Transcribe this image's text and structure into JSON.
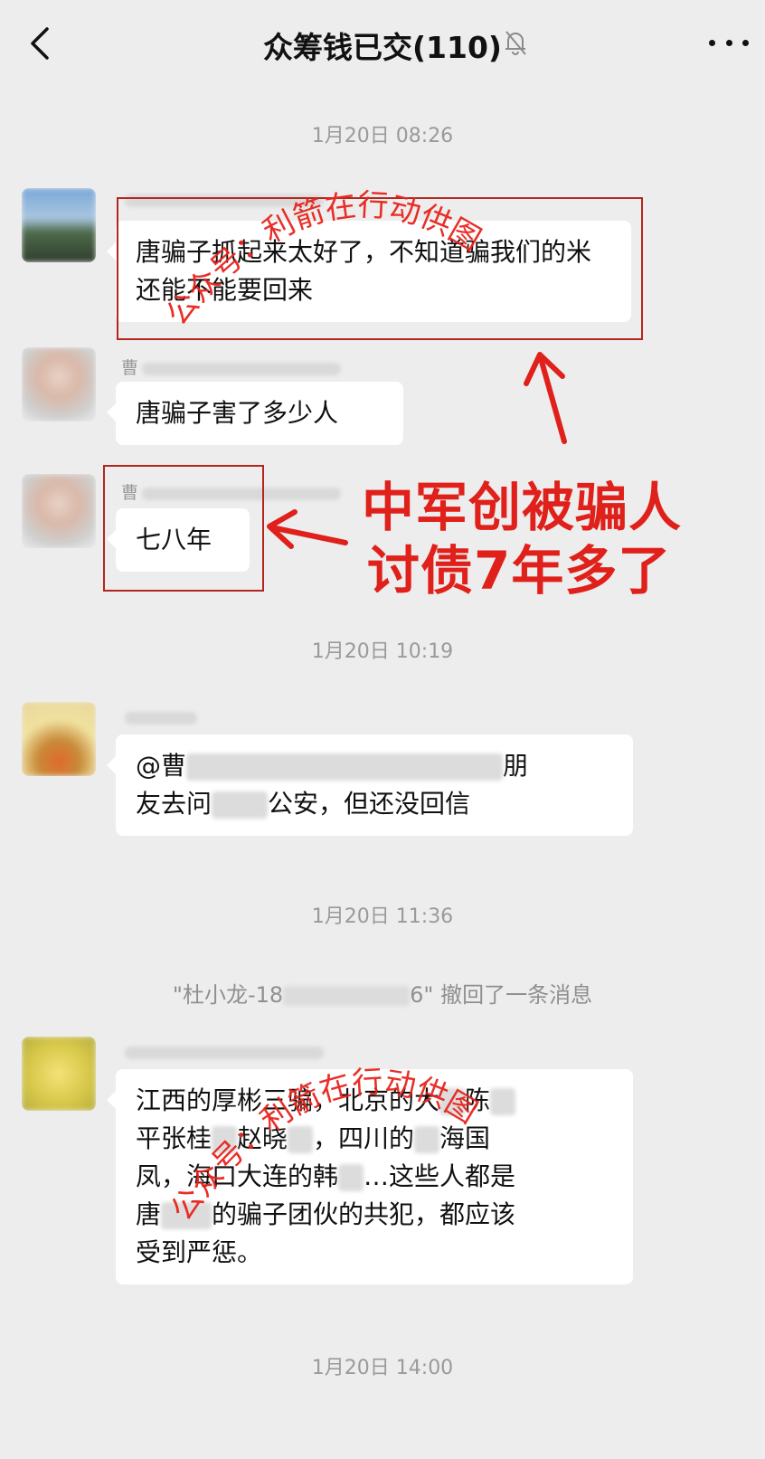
{
  "header": {
    "title": "众筹钱已交(110)",
    "back_icon": "chevron-left-icon",
    "mute_icon": "bell-off-icon",
    "more_icon": "more-dots-icon"
  },
  "times": [
    "1月20日 08:26",
    "1月20日 10:19",
    "1月20日 11:36",
    "1月20日 14:00"
  ],
  "messages": [
    {
      "nickname": "",
      "text": "唐骗子抓起来太好了，不知道骗我们的米还能不能要回来"
    },
    {
      "nickname": "曹",
      "text": "唐骗子害了多少人"
    },
    {
      "nickname": "曹",
      "text": "七八年"
    },
    {
      "nickname": "",
      "text_a": "@曹",
      "text_b": "朋",
      "text_c": "友去问",
      "text_d": "公安，但还没回信"
    },
    {
      "nickname": "",
      "line1_a": "江西的厚彬三骗，北京的大",
      "line1_b": "陈",
      "line2_a": "平张桂",
      "line2_b": "赵晓",
      "line2_c": "，四川的",
      "line2_d": "海国",
      "line3_a": "凤，海口大连的韩",
      "line3_b": "…这些人都是",
      "line4_a": "唐",
      "line4_b": "的骗子团伙的共犯，都应该",
      "line5": "受到严惩。"
    }
  ],
  "system": {
    "prefix": "\"杜小龙-18",
    "suffix": "6\" 撤回了一条消息"
  },
  "annotation": {
    "line1": "中军创被骗人",
    "line2": "讨债7年多了"
  },
  "watermark": {
    "text": "公众号：利箭在行动供图"
  },
  "colors": {
    "annotation_red": "#e0201a",
    "box_red": "#b3261e",
    "background": "#ededed"
  }
}
